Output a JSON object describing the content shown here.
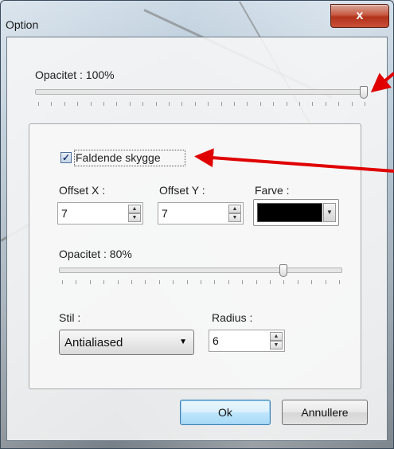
{
  "window": {
    "title": "Option",
    "close_label": "x"
  },
  "opacity": {
    "label": "Opacitet : 100%",
    "value": 1.0
  },
  "shadow": {
    "checkbox_label": "Faldende skygge",
    "checked": true,
    "offset_x_label": "Offset X :",
    "offset_x_value": "7",
    "offset_y_label": "Offset Y :",
    "offset_y_value": "7",
    "color_label": "Farve :",
    "color_value": "#000000",
    "opacity_label": "Opacitet : 80%",
    "opacity_value": 0.8,
    "style_label": "Stil :",
    "style_value": "Antialiased",
    "radius_label": "Radius :",
    "radius_value": "6"
  },
  "buttons": {
    "ok": "Ok",
    "cancel": "Annullere"
  },
  "colors": {
    "annotation_arrow": "#e00000",
    "default_button_border": "#3c7fb1",
    "close_button": "#c8503a"
  },
  "icons": {
    "spin_up": "arrow-up-icon",
    "spin_down": "arrow-down-icon",
    "dropdown": "chevron-down-icon"
  }
}
